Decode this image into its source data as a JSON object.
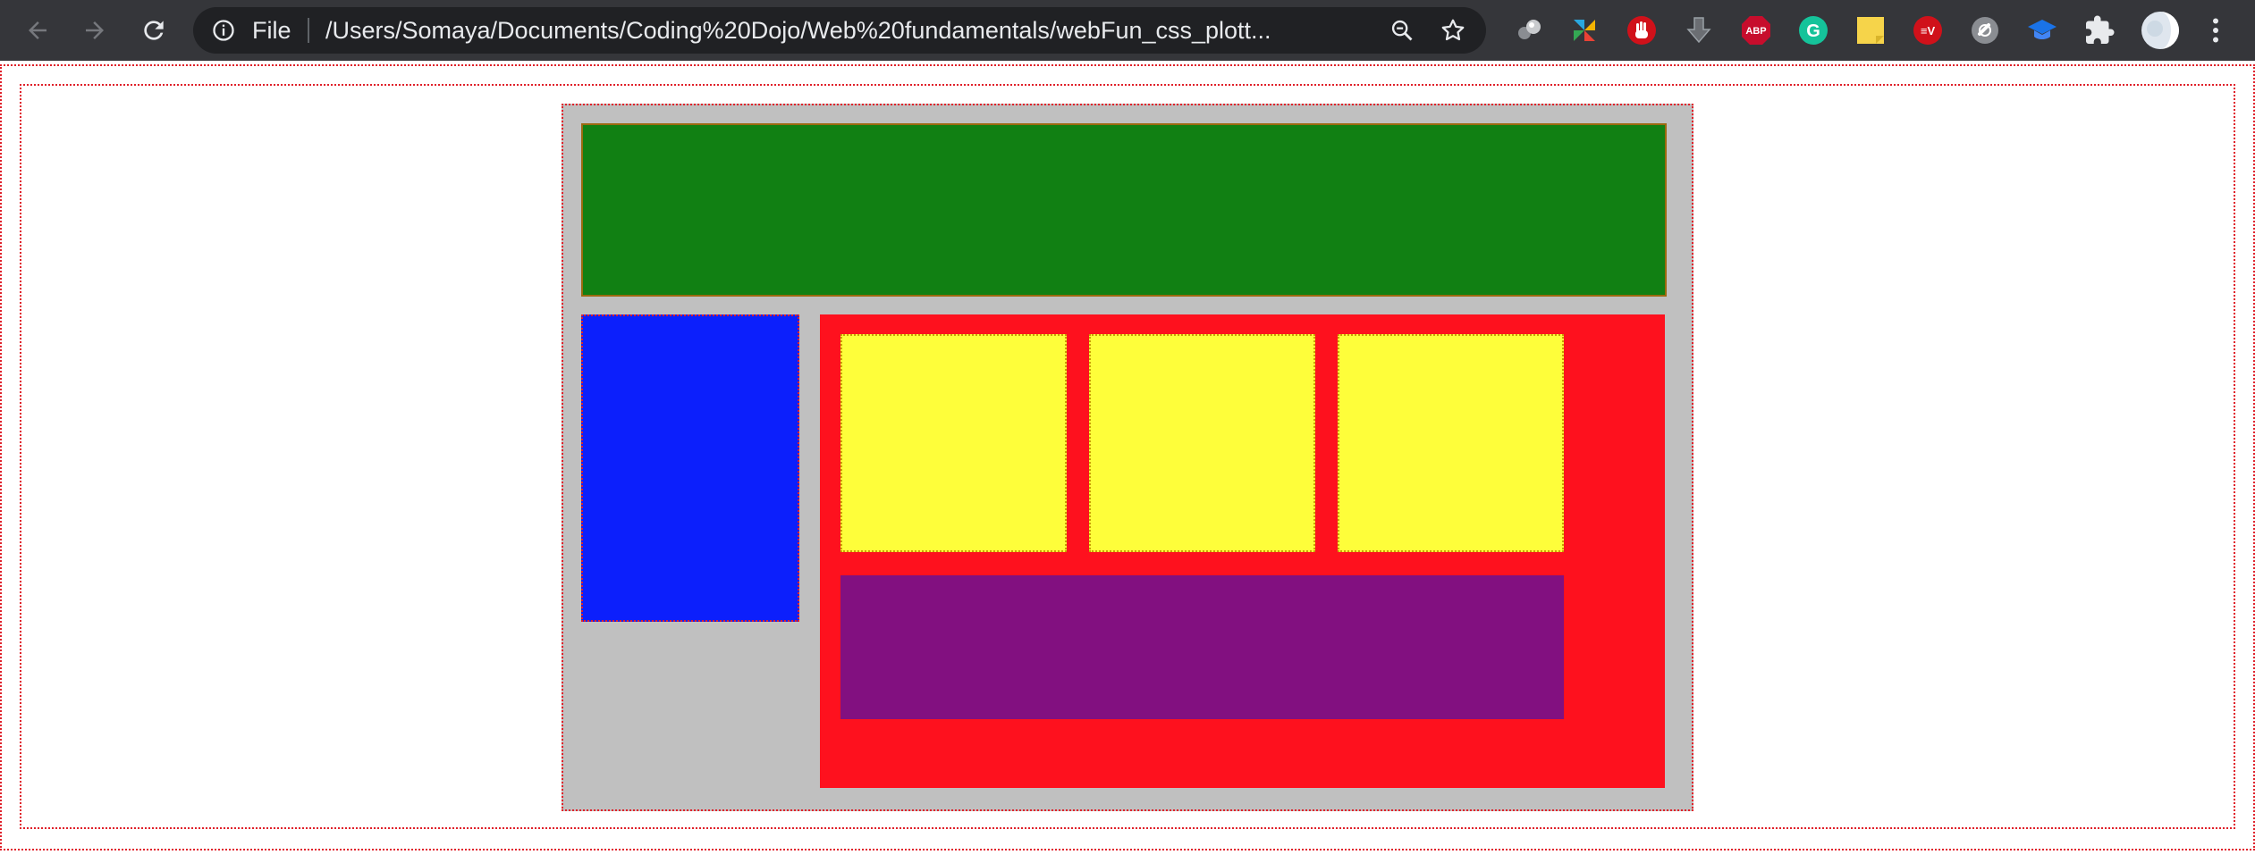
{
  "browser": {
    "scheme_label": "File",
    "url": "/Users/Somaya/Documents/Coding%20Dojo/Web%20fundamentals/webFun_css_plott..."
  },
  "colors": {
    "toolbar": "#35363a",
    "omnibox": "#202124",
    "outline": "#e0202a",
    "container": "#c0c0c0",
    "header": "#118013",
    "sidebar": "#0c1ffc",
    "main": "#fe111e",
    "box": "#fefe3a",
    "footer": "#821080"
  },
  "icons": {
    "back": "arrow-left-icon",
    "forward": "arrow-right-icon",
    "reload": "reload-icon",
    "info": "info-icon",
    "zoom": "zoom-out-icon",
    "bookmark": "star-icon",
    "extensions": [
      "spheres-icon",
      "pinwheel-icon",
      "hand-icon",
      "download-arrow-icon",
      "adblock-plus-icon",
      "grammarly-icon",
      "sticky-note-icon",
      "ev-icon",
      "link-icon",
      "graduation-cap-icon",
      "puzzle-icon"
    ],
    "profile": "avatar-icon",
    "menu": "more-vert-icon"
  },
  "extensions": {
    "adblock_label": "ABP",
    "grammarly_label": "G",
    "ev_label": "≡V"
  }
}
